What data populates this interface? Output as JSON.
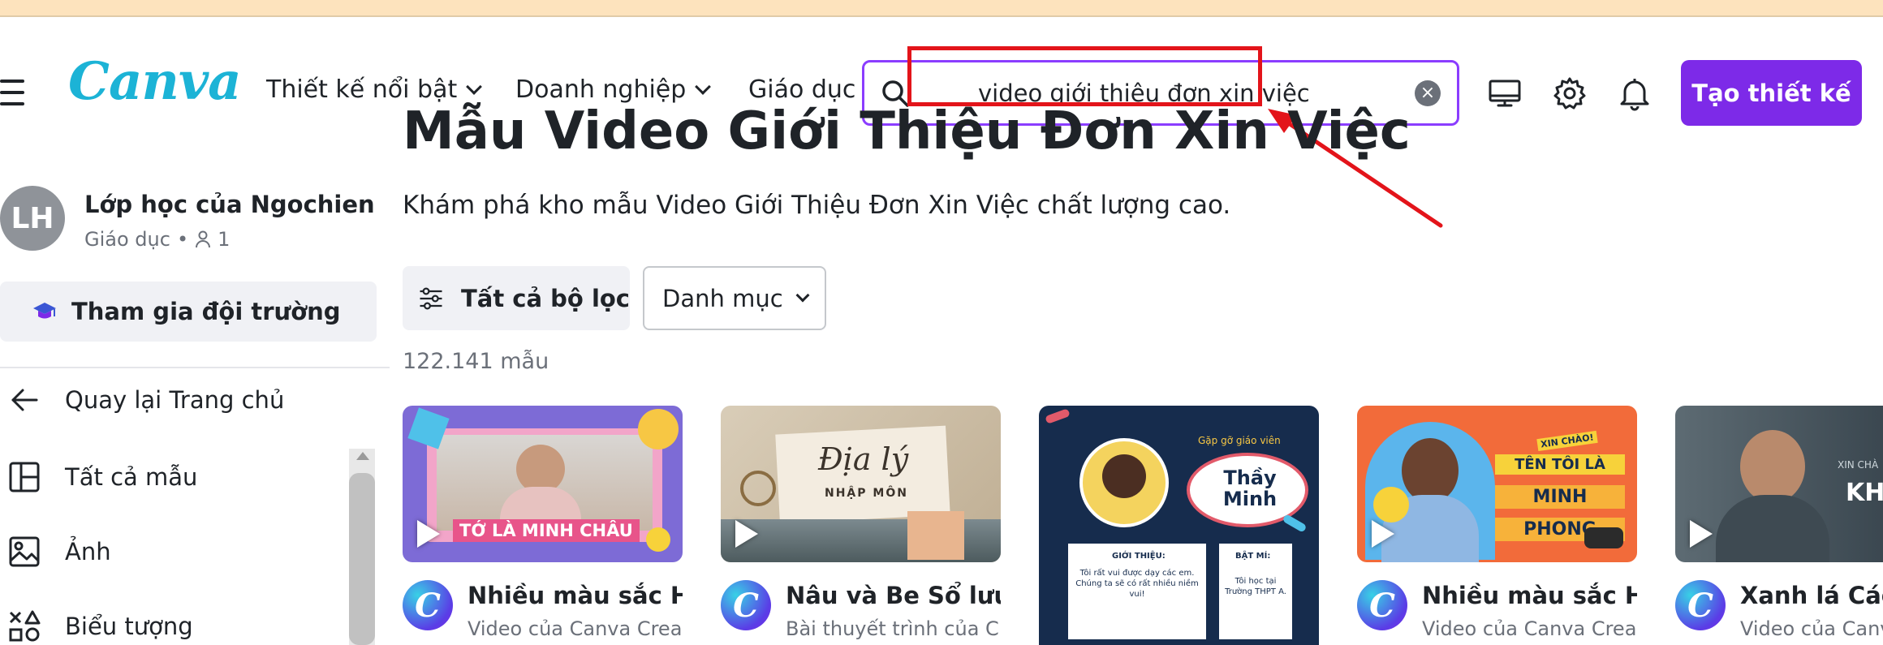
{
  "header": {
    "logo": "Canva",
    "nav": [
      {
        "label": "Thiết kế nổi bật"
      },
      {
        "label": "Doanh nghiệp"
      },
      {
        "label": "Giáo dục"
      }
    ],
    "search": {
      "value": "video giới thiệu đơn xin việc"
    },
    "create_label": "Tạo thiết kế"
  },
  "sidebar": {
    "avatar_initials": "LH",
    "team_name": "Lớp học của Ngochien",
    "team_type": "Giáo dục",
    "team_separator": "•",
    "member_count": "1",
    "join_label": "Tham gia đội trường",
    "back_label": "Quay lại Trang chủ",
    "items": [
      {
        "label": "Tất cả mẫu"
      },
      {
        "label": "Ảnh"
      },
      {
        "label": "Biểu tượng"
      }
    ]
  },
  "main": {
    "title": "Mẫu Video Giới Thiệu Đơn Xin Việc",
    "description": "Khám phá kho mẫu Video Giới Thiệu Đơn Xin Việc chất lượng cao.",
    "filter_label": "Tất cả bộ lọc",
    "category_label": "Danh mục",
    "count": "122.141 mẫu",
    "cards": [
      {
        "title": "Nhiều màu sắc H...",
        "subtitle": "Video của Canva Crea...",
        "thumb_text": "TỚ LÀ MINH CHÂU"
      },
      {
        "title": "Nâu và Be Sổ lưu ...",
        "subtitle": "Bài thuyết trình của C...",
        "thumb_text": "Địa lý",
        "thumb_text2": "NHẬP MÔN"
      },
      {
        "title": "",
        "subtitle": "",
        "thumb_text": "Thầy Minh",
        "thumb_text2": "Gặp gỡ giáo viên",
        "thumb_text3": "GIỚI THIỆU:",
        "thumb_text4": "Tôi rất vui được dạy các em. Chúng ta sẽ có rất nhiều niềm vui!",
        "thumb_text5": "BẬT MÍ:",
        "thumb_text6": "Tôi học tại Trường THPT A."
      },
      {
        "title": "Nhiều màu sắc H...",
        "subtitle": "Video của Canva Crea...",
        "thumb_text": "TÊN TÔI LÀ",
        "thumb_text2": "MINH",
        "thumb_text3": "PHONG",
        "thumb_text4": "XIN CHÀO!"
      },
      {
        "title": "Xanh lá Cách",
        "subtitle": "Video của Canva",
        "thumb_text": "KH",
        "thumb_text2": "XIN CHÀ"
      }
    ]
  },
  "colors": {
    "brand": "#7d2ae8",
    "search_border": "#8b3dff",
    "highlight": "#e3141a"
  }
}
